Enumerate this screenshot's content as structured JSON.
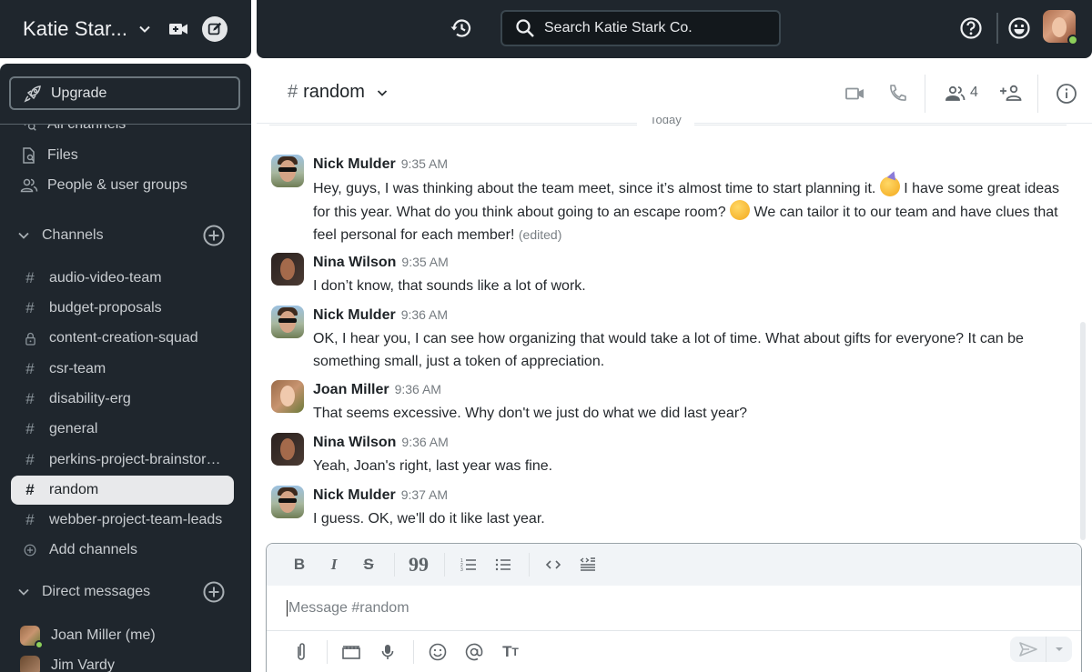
{
  "workspace": {
    "name": "Katie Star...",
    "full_name": "Katie Stark Co."
  },
  "top_bar": {
    "search_placeholder": "Search Katie Stark Co.",
    "icons": [
      "history-icon",
      "search-icon",
      "help-icon",
      "emoji-status-icon",
      "user-avatar"
    ],
    "user_status_color": "#8ccf5a"
  },
  "sidebar": {
    "upgrade_label": "Upgrade",
    "nav": [
      {
        "label": "All channels",
        "icon": "browse-channels-icon"
      },
      {
        "label": "Files",
        "icon": "file-search-icon"
      },
      {
        "label": "People & user groups",
        "icon": "people-icon"
      }
    ],
    "channels_header": "Channels",
    "channels": [
      {
        "name": "audio-video-team",
        "type": "public"
      },
      {
        "name": "budget-proposals",
        "type": "public"
      },
      {
        "name": "content-creation-squad",
        "type": "private"
      },
      {
        "name": "csr-team",
        "type": "public"
      },
      {
        "name": "disability-erg",
        "type": "public"
      },
      {
        "name": "general",
        "type": "public"
      },
      {
        "name": "perkins-project-brainstor…",
        "type": "public"
      },
      {
        "name": "random",
        "type": "public",
        "active": true
      },
      {
        "name": "webber-project-team-leads",
        "type": "public"
      }
    ],
    "add_channels_label": "Add channels",
    "dm_header": "Direct messages",
    "direct_messages": [
      {
        "name": "Joan Miller (me)",
        "status": "online"
      },
      {
        "name": "Jim Vardy",
        "status": "offline"
      }
    ]
  },
  "channel": {
    "hash": "#",
    "name": "random",
    "member_count": "4",
    "date_divider": "Today",
    "composer_placeholder": "Message #random"
  },
  "messages": [
    {
      "author": "Nick Mulder",
      "time": "9:35 AM",
      "text_parts": [
        "Hey, guys, I was thinking about the team meet, since it’s almost time to start planning it. ",
        " I have some great ideas for this year. What do you think about going to an escape room? ",
        " We can tailor it to our team and have clues that feel personal for each member! "
      ],
      "emojis": [
        "partying-face",
        "face-with-hand-over-mouth"
      ],
      "edited": "(edited)"
    },
    {
      "author": "Nina Wilson",
      "time": "9:35 AM",
      "text": "I don’t know, that sounds like a lot of work."
    },
    {
      "author": "Nick Mulder",
      "time": "9:36 AM",
      "text": "OK, I hear you, I can see how organizing that would take a lot of time. What about gifts for everyone? It can be something small, just a token of appreciation."
    },
    {
      "author": "Joan Miller",
      "time": "9:36 AM",
      "text": "That seems excessive. Why don't we just do what we did last year?"
    },
    {
      "author": "Nina Wilson",
      "time": "9:36 AM",
      "text": "Yeah, Joan's right, last year was fine."
    },
    {
      "author": "Nick Mulder",
      "time": "9:37 AM",
      "text": "I guess. OK, we'll do it like last year."
    }
  ],
  "composer": {
    "format_tools": [
      "bold",
      "italic",
      "strikethrough",
      "quote",
      "numbered-list",
      "bulleted-list",
      "code",
      "code-block"
    ],
    "action_tools": [
      "attach",
      "gif",
      "voice",
      "emoji",
      "mention",
      "text-formatting"
    ]
  }
}
